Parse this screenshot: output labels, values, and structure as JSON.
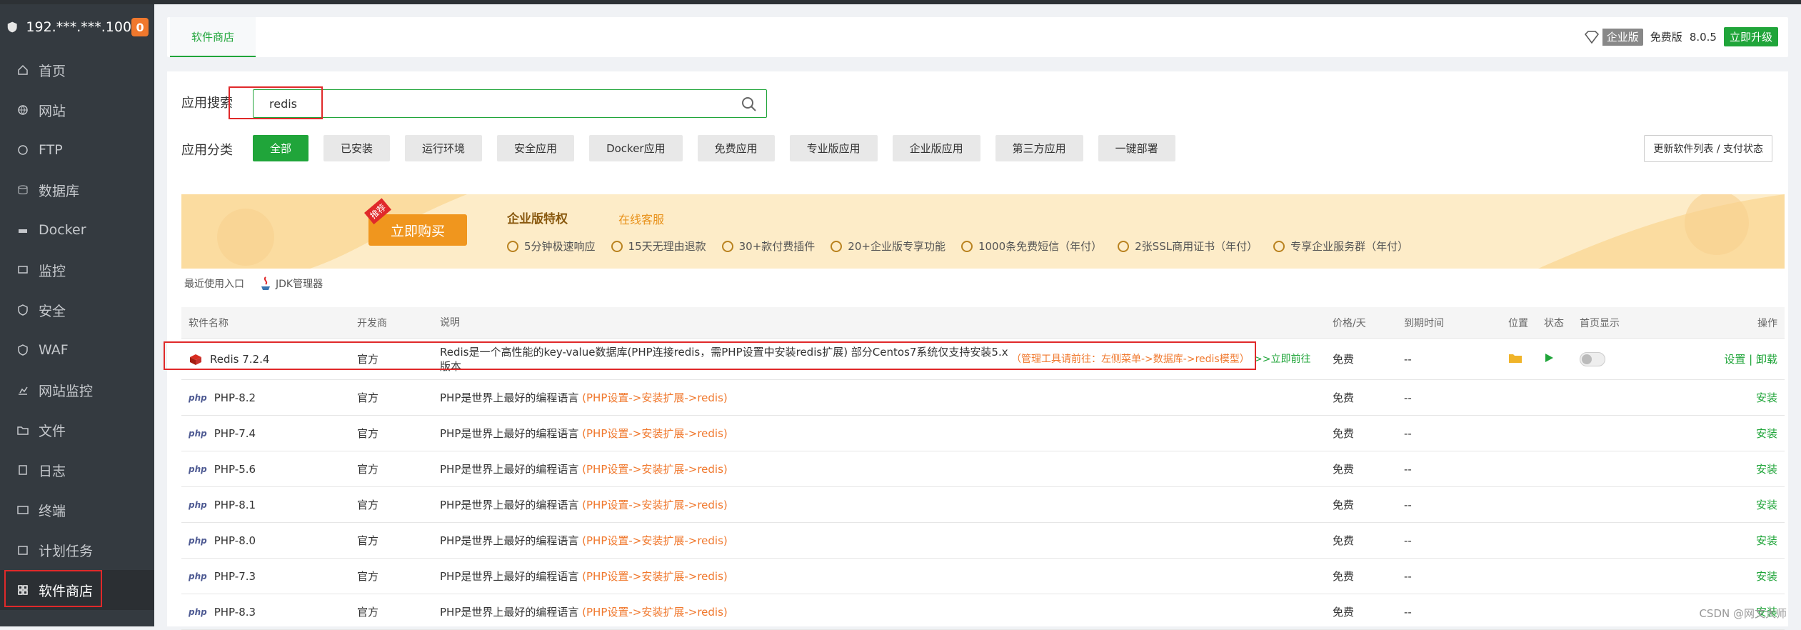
{
  "server": {
    "ip": "192.***.***.100",
    "badge": "0"
  },
  "sidebar": {
    "items": [
      {
        "label": "首页",
        "icon": "home-icon"
      },
      {
        "label": "网站",
        "icon": "globe-icon"
      },
      {
        "label": "FTP",
        "icon": "ftp-icon"
      },
      {
        "label": "数据库",
        "icon": "database-icon"
      },
      {
        "label": "Docker",
        "icon": "docker-icon"
      },
      {
        "label": "监控",
        "icon": "monitor-icon"
      },
      {
        "label": "安全",
        "icon": "shield-icon"
      },
      {
        "label": "WAF",
        "icon": "waf-icon"
      },
      {
        "label": "网站监控",
        "icon": "chart-icon"
      },
      {
        "label": "文件",
        "icon": "folder-icon"
      },
      {
        "label": "日志",
        "icon": "log-icon"
      },
      {
        "label": "终端",
        "icon": "terminal-icon"
      },
      {
        "label": "计划任务",
        "icon": "calendar-icon"
      },
      {
        "label": "软件商店",
        "icon": "grid-icon",
        "active": true
      }
    ]
  },
  "header": {
    "tab": "软件商店",
    "edition": "企业版",
    "free_label": "免费版",
    "version": "8.0.5",
    "upgrade": "立即升级"
  },
  "search": {
    "label": "应用搜索",
    "value": "redis"
  },
  "categories": {
    "label": "应用分类",
    "items": [
      "全部",
      "已安装",
      "运行环境",
      "安全应用",
      "Docker应用",
      "免费应用",
      "专业版应用",
      "企业版应用",
      "第三方应用",
      "一键部署"
    ],
    "refresh": "更新软件列表 / 支付状态"
  },
  "banner": {
    "tag": "推荐",
    "buy": "立即购买",
    "title": "企业版特权",
    "online": "在线客服",
    "features": [
      "5分钟极速响应",
      "15天无理由退款",
      "30+款付费插件",
      "20+企业版专享功能",
      "1000条免费短信（年付）",
      "2张SSL商用证书（年付）",
      "专享企业服务群（年付）"
    ]
  },
  "recent": {
    "label": "最近使用入口",
    "item": "JDK管理器"
  },
  "table": {
    "headers": [
      "软件名称",
      "开发商",
      "说明",
      "价格/天",
      "到期时间",
      "位置",
      "状态",
      "首页显示",
      "操作"
    ],
    "redis": {
      "name": "Redis 7.2.4",
      "vendor": "官方",
      "desc": "Redis是一个高性能的key-value数据库(PHP连接redis，需PHP设置中安装redis扩展) 部分Centos7系统仅支持安装5.x版本",
      "hint": "（管理工具请前往：左侧菜单->数据库->redis模型）",
      "go": ">>立即前往",
      "price": "免费",
      "expire": "--",
      "actions": "设置 | 卸载"
    },
    "php_rows": [
      {
        "name": "PHP-8.2",
        "vendor": "官方",
        "desc": "PHP是世界上最好的编程语言",
        "hint": "(PHP设置->安装扩展->redis)",
        "price": "免费",
        "expire": "--",
        "action": "安装"
      },
      {
        "name": "PHP-7.4",
        "vendor": "官方",
        "desc": "PHP是世界上最好的编程语言",
        "hint": "(PHP设置->安装扩展->redis)",
        "price": "免费",
        "expire": "--",
        "action": "安装"
      },
      {
        "name": "PHP-5.6",
        "vendor": "官方",
        "desc": "PHP是世界上最好的编程语言",
        "hint": "(PHP设置->安装扩展->redis)",
        "price": "免费",
        "expire": "--",
        "action": "安装"
      },
      {
        "name": "PHP-8.1",
        "vendor": "官方",
        "desc": "PHP是世界上最好的编程语言",
        "hint": "(PHP设置->安装扩展->redis)",
        "price": "免费",
        "expire": "--",
        "action": "安装"
      },
      {
        "name": "PHP-8.0",
        "vendor": "官方",
        "desc": "PHP是世界上最好的编程语言",
        "hint": "(PHP设置->安装扩展->redis)",
        "price": "免费",
        "expire": "--",
        "action": "安装"
      },
      {
        "name": "PHP-7.3",
        "vendor": "官方",
        "desc": "PHP是世界上最好的编程语言",
        "hint": "(PHP设置->安装扩展->redis)",
        "price": "免费",
        "expire": "--",
        "action": "安装"
      },
      {
        "name": "PHP-8.3",
        "vendor": "官方",
        "desc": "PHP是世界上最好的编程语言",
        "hint": "(PHP设置->安装扩展->redis)",
        "price": "免费",
        "expire": "--",
        "action": "安装"
      }
    ],
    "php_logo": "php"
  },
  "watermark": "CSDN @网文大师"
}
